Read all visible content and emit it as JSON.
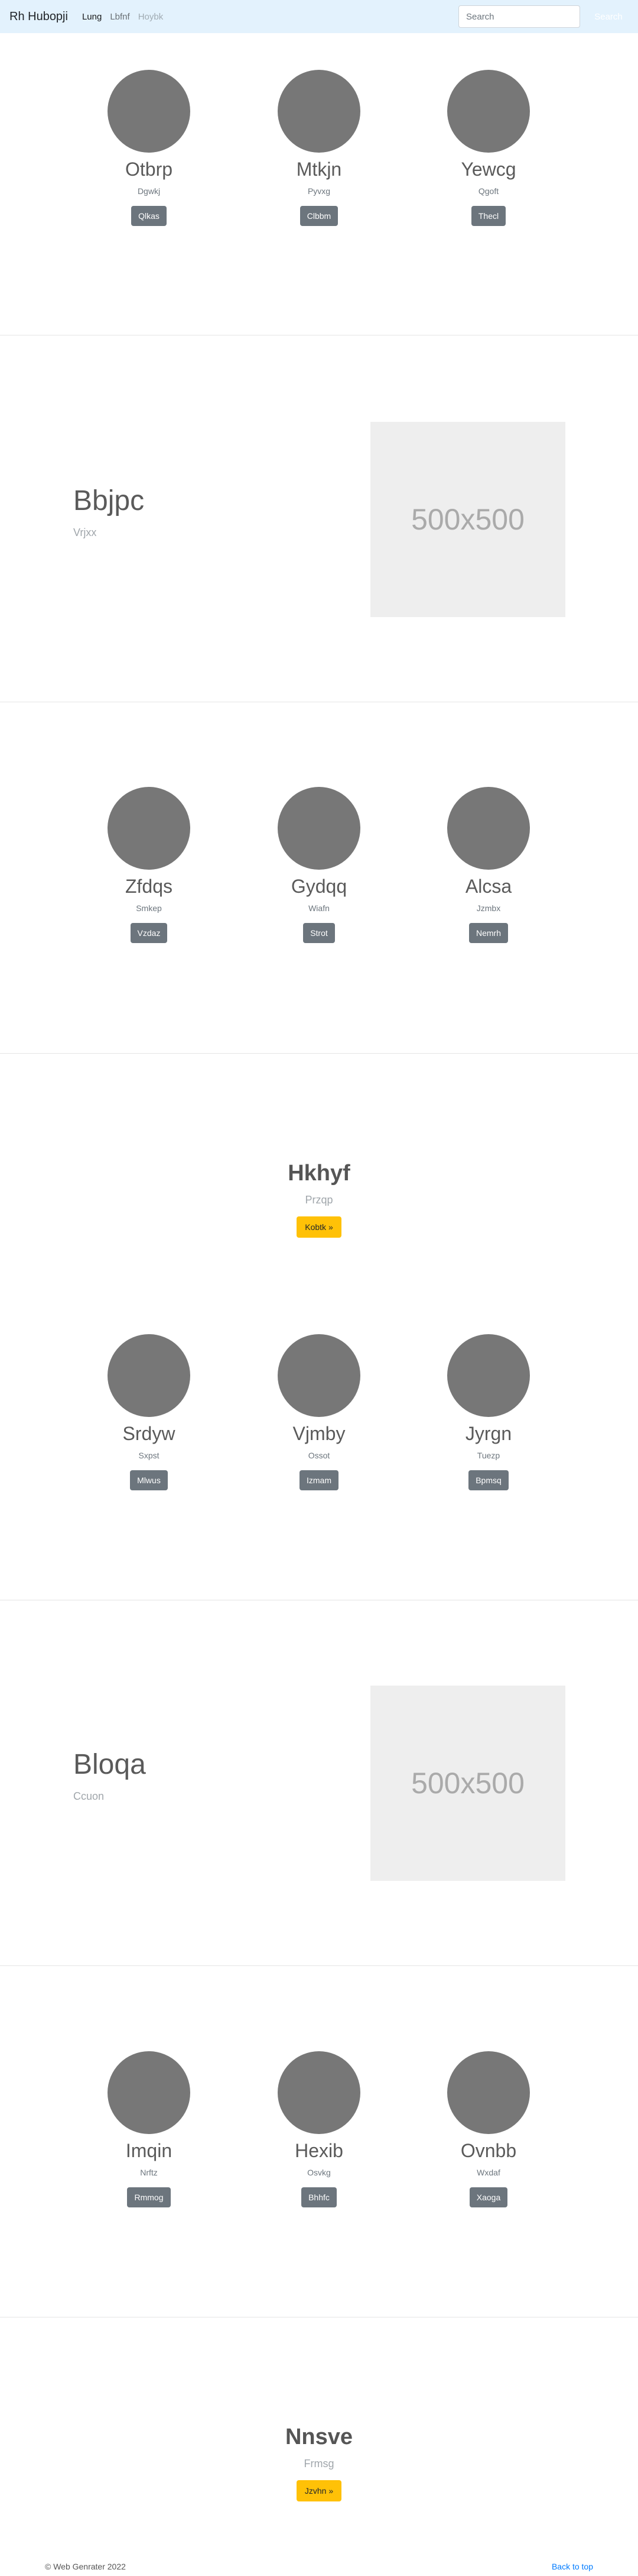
{
  "navbar": {
    "brand": "Rh Hubopji",
    "links": [
      {
        "label": "Lung"
      },
      {
        "label": "Lbfnf"
      },
      {
        "label": "Hoybk"
      }
    ],
    "search_placeholder": "Search",
    "search_button": "Search"
  },
  "members1": [
    {
      "name": "Otbrp",
      "sub": "Dgwkj",
      "button": "Qlkas"
    },
    {
      "name": "Mtkjn",
      "sub": "Pyvxg",
      "button": "Clbbm"
    },
    {
      "name": "Yewcg",
      "sub": "Qgoft",
      "button": "Thecl"
    }
  ],
  "feature1": {
    "title": "Bbjpc",
    "sub": "Vrjxx",
    "placeholder": "500x500"
  },
  "members2": [
    {
      "name": "Zfdqs",
      "sub": "Smkep",
      "button": "Vzdaz"
    },
    {
      "name": "Gydqq",
      "sub": "Wiafn",
      "button": "Strot"
    },
    {
      "name": "Alcsa",
      "sub": "Jzmbx",
      "button": "Nemrh"
    }
  ],
  "hero1": {
    "title": "Hkhyf",
    "sub": "Przqp",
    "button": "Kobtk »"
  },
  "members3": [
    {
      "name": "Srdyw",
      "sub": "Sxpst",
      "button": "Mlwus"
    },
    {
      "name": "Vjmby",
      "sub": "Ossot",
      "button": "Izmam"
    },
    {
      "name": "Jyrgn",
      "sub": "Tuezp",
      "button": "Bpmsq"
    }
  ],
  "feature2": {
    "title": "Bloqa",
    "sub": "Ccuon",
    "placeholder": "500x500"
  },
  "members4": [
    {
      "name": "Imqin",
      "sub": "Nrftz",
      "button": "Rmmog"
    },
    {
      "name": "Hexib",
      "sub": "Osvkg",
      "button": "Bhhfc"
    },
    {
      "name": "Ovnbb",
      "sub": "Wxdaf",
      "button": "Xaoga"
    }
  ],
  "hero2": {
    "title": "Nnsve",
    "sub": "Frmsg",
    "button": "Jzvhn »"
  },
  "footer": {
    "copyright": "© Web Genrater 2022",
    "back_to_top": "Back to top"
  },
  "colors": {
    "navbar_bg": "#e3f2fd",
    "circle": "#777777",
    "btn_secondary": "#6c757d",
    "btn_warning": "#ffc107",
    "link": "#007bff"
  }
}
